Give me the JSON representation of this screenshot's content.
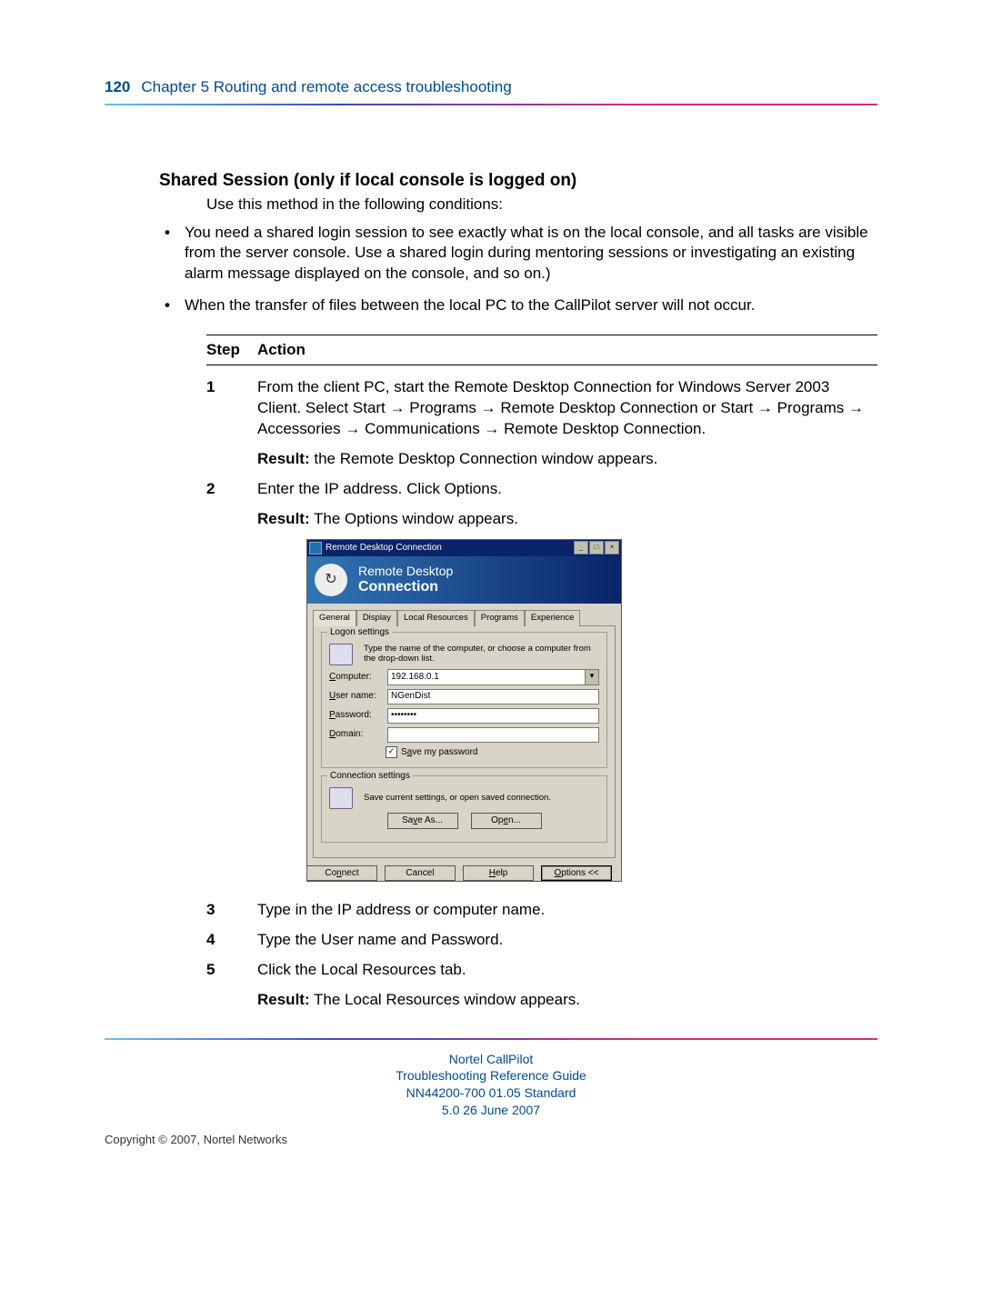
{
  "header": {
    "page_number": "120",
    "chapter": "Chapter 5  Routing and remote access troubleshooting"
  },
  "section": {
    "title": "Shared Session (only if local console is logged on)",
    "intro": "Use this method in the following conditions:",
    "bullets": [
      "You need a shared login session to see exactly what is on the local console, and all tasks are visible from the server console. Use a shared login during mentoring sessions or investigating an existing alarm message displayed on the console, and so on.)",
      "When the transfer of files between the local PC to the CallPilot server will not occur."
    ]
  },
  "table": {
    "head_step": "Step",
    "head_action": "Action",
    "rows": [
      {
        "num": "1",
        "action": "From the client PC, start the Remote Desktop Connection for Windows Server 2003 Client. Select Start → Programs → Remote Desktop Connection or Start → Programs → Accessories → Communications → Remote Desktop Connection.",
        "result_label": "Result:",
        "result_text": " the Remote Desktop Connection window appears."
      },
      {
        "num": "2",
        "action": "Enter the IP address. Click Options.",
        "result_label": "Result:",
        "result_text": " The Options window appears."
      },
      {
        "num": "3",
        "action": "Type in the IP address or computer name."
      },
      {
        "num": "4",
        "action": "Type the User name and Password."
      },
      {
        "num": "5",
        "action": "Click the Local Resources tab.",
        "result_label": "Result:",
        "result_text": " The Local Resources window appears."
      }
    ]
  },
  "dialog": {
    "title": "Remote Desktop Connection",
    "banner_line1": "Remote Desktop",
    "banner_line2": "Connection",
    "tabs": [
      "General",
      "Display",
      "Local Resources",
      "Programs",
      "Experience"
    ],
    "group1_legend": "Logon settings",
    "group1_desc": "Type the name of the computer, or choose a computer from the drop-down list.",
    "computer_label": "Computer:",
    "computer_value": "192.168.0.1",
    "username_label": "User name:",
    "username_value": "NGenDist",
    "password_label": "Password:",
    "password_value": "••••••••",
    "domain_label": "Domain:",
    "domain_value": "",
    "save_pw_label": "Save my password",
    "group2_legend": "Connection settings",
    "group2_desc": "Save current settings, or open saved connection.",
    "btn_saveas": "Save As...",
    "btn_open": "Open...",
    "btn_connect": "Connect",
    "btn_cancel": "Cancel",
    "btn_help": "Help",
    "btn_options": "Options <<"
  },
  "footer": {
    "line1": "Nortel CallPilot",
    "line2": "Troubleshooting Reference Guide",
    "line3": "NN44200-700   01.05   Standard",
    "line4": "5.0   26 June 2007",
    "copyright": "Copyright © 2007, Nortel Networks"
  }
}
